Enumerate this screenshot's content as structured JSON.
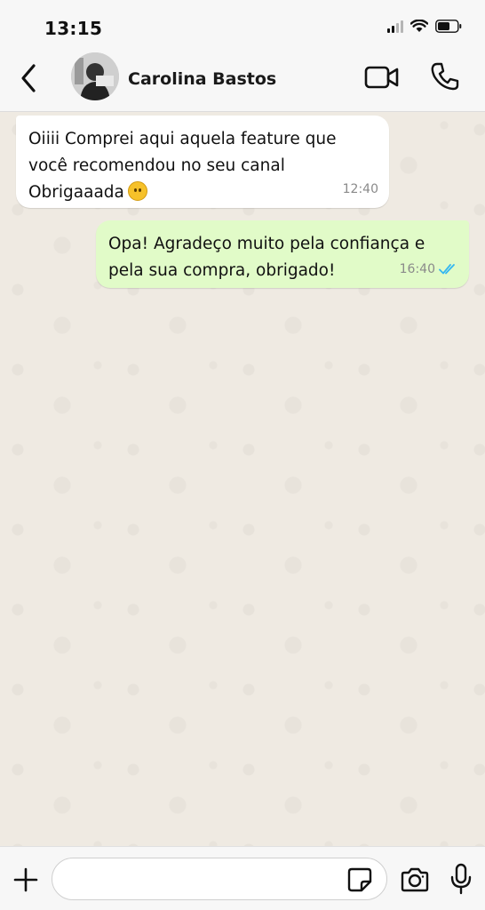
{
  "status_bar": {
    "time": "13:15"
  },
  "header": {
    "contact_name": "Carolina Bastos",
    "icons": {
      "back": "chevron-left-icon",
      "video": "video-camera-icon",
      "call": "phone-icon"
    }
  },
  "messages": [
    {
      "direction": "incoming",
      "lines": [
        "Oiiii Comprei aqui aquela feature que",
        "você recomendou no seu canal",
        "Obrigaaada"
      ],
      "emoji": "hushed-face",
      "time": "12:40"
    },
    {
      "direction": "outgoing",
      "lines": [
        "Opa! Agradeço muito pela confiança e",
        "pela sua compra, obrigado!"
      ],
      "time": "16:40",
      "status": "read",
      "status_color": "#34b7f1"
    }
  ],
  "composer": {
    "value": "",
    "placeholder": "",
    "icons": {
      "attach": "plus-icon",
      "sticker": "sticker-icon",
      "camera": "camera-icon",
      "mic": "microphone-icon"
    }
  },
  "colors": {
    "incoming_bubble": "#ffffff",
    "outgoing_bubble": "#e1fbc8",
    "chat_background": "#efeae2",
    "bar_background": "#f7f7f7"
  }
}
